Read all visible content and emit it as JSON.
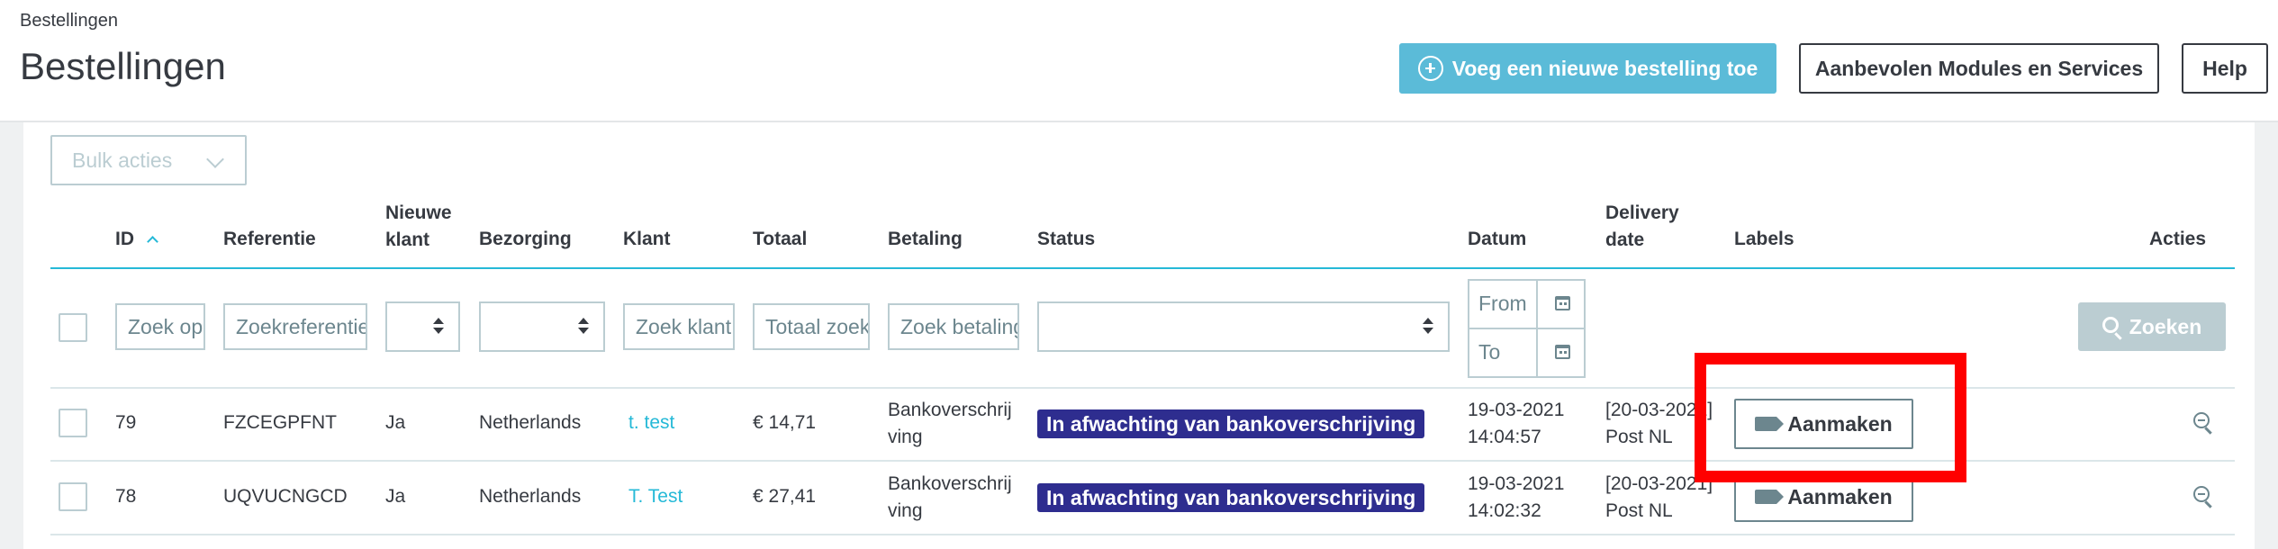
{
  "header": {
    "breadcrumb": "Bestellingen",
    "title": "Bestellingen",
    "add_order_label": "Voeg een nieuwe bestelling toe",
    "modules_label": "Aanbevolen Modules en Services",
    "help_label": "Help"
  },
  "toolbar": {
    "bulk_label": "Bulk acties",
    "search_label": "Zoeken"
  },
  "columns": {
    "id": "ID",
    "referentie": "Referentie",
    "nieuwe_klant_1": "Nieuwe",
    "nieuwe_klant_2": "klant",
    "bezorging": "Bezorging",
    "klant": "Klant",
    "totaal": "Totaal",
    "betaling": "Betaling",
    "status": "Status",
    "datum": "Datum",
    "delivery_1": "Delivery",
    "delivery_2": "date",
    "labels": "Labels",
    "acties": "Acties"
  },
  "filters": {
    "id_placeholder": "Zoek op ID",
    "ref_placeholder": "Zoekreferentie",
    "klant_placeholder": "Zoek klant",
    "totaal_placeholder": "Totaal zoeken",
    "betaling_placeholder": "Zoek betaling",
    "date_from": "From",
    "date_to": "To"
  },
  "rows": [
    {
      "id": "79",
      "referentie": "FZCEGPFNT",
      "nieuwe_klant": "Ja",
      "bezorging": "Netherlands",
      "klant": "t. test",
      "totaal": "€ 14,71",
      "betaling_1": "Bankoverschrij",
      "betaling_2": "ving",
      "status": "In afwachting van bankoverschrijving",
      "datum_1": "19-03-2021",
      "datum_2": "14:04:57",
      "delivery_1": "[20-03-2021]",
      "delivery_2": "Post NL",
      "label_button": "Aanmaken"
    },
    {
      "id": "78",
      "referentie": "UQVUCNGCD",
      "nieuwe_klant": "Ja",
      "bezorging": "Netherlands",
      "klant": "T. Test",
      "totaal": "€ 27,41",
      "betaling_1": "Bankoverschrij",
      "betaling_2": "ving",
      "status": "In afwachting van bankoverschrijving",
      "datum_1": "19-03-2021",
      "datum_2": "14:02:32",
      "delivery_1": "[20-03-2021]",
      "delivery_2": "Post NL",
      "label_button": "Aanmaken"
    }
  ],
  "colors": {
    "primary": "#5bbbd8",
    "status_badge": "#2e2d8f",
    "link": "#25b9d7",
    "highlight": "#ff0000"
  }
}
